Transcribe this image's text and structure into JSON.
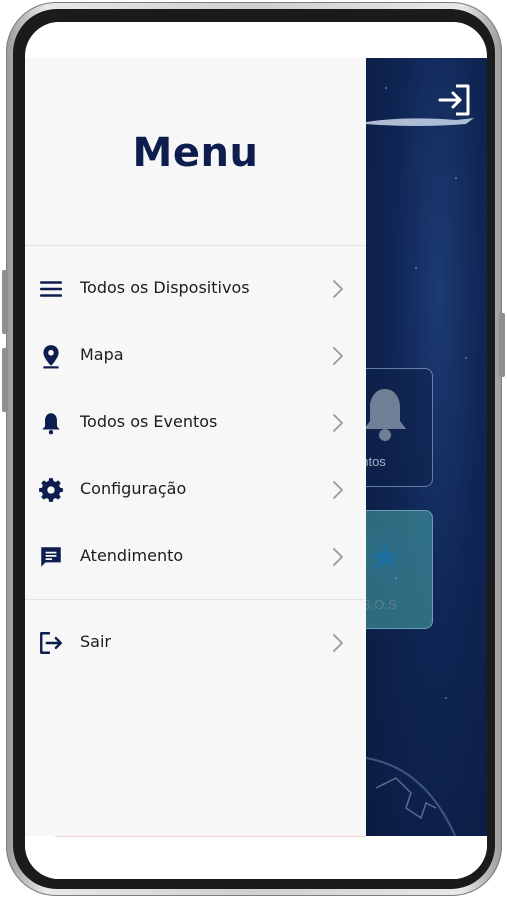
{
  "drawer": {
    "title": "Menu",
    "items": [
      {
        "label": "Todos os Dispositivos",
        "icon": "list-icon"
      },
      {
        "label": "Mapa",
        "icon": "location-pin-icon"
      },
      {
        "label": "Todos os Eventos",
        "icon": "bell-icon"
      },
      {
        "label": "Configuração",
        "icon": "gear-icon"
      },
      {
        "label": "Atendimento",
        "icon": "chat-icon"
      }
    ],
    "logout": {
      "label": "Sair",
      "icon": "logout-icon"
    }
  },
  "background_app": {
    "events_card_label": "entos",
    "sos_card_label": "S.O.S"
  },
  "colors": {
    "primary": "#0d1d4d",
    "drawer_bg": "#f7f7f7",
    "background_blue": "#0f2553",
    "sos_teal": "#48aaaa"
  }
}
